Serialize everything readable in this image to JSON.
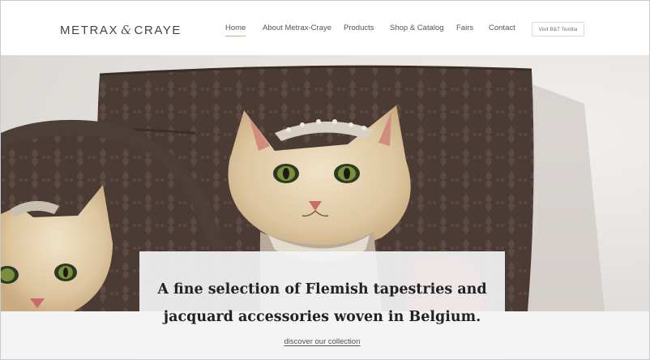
{
  "brand": {
    "name_left": "METRAX",
    "ampersand": "&",
    "name_right": "CRAYE"
  },
  "nav": {
    "items": [
      {
        "label": "Home",
        "active": true
      },
      {
        "label": "About Metrax-Craye",
        "active": false
      },
      {
        "label": "Products",
        "active": false
      },
      {
        "label": "Shop & Catalog",
        "active": false
      },
      {
        "label": "Fairs",
        "active": false
      },
      {
        "label": "Contact",
        "active": false
      }
    ],
    "cta_label": "Visit B&T Textilia"
  },
  "hero": {
    "headline_line1": "A fine selection of Flemish tapestries and",
    "headline_line2": "jacquard accessories woven in Belgium.",
    "link_label": "discover our collection"
  },
  "colors": {
    "accent_underline": "#c4b49a",
    "cushion_brown": "#4a3a33",
    "caption_bg": "#f3f3f4"
  }
}
